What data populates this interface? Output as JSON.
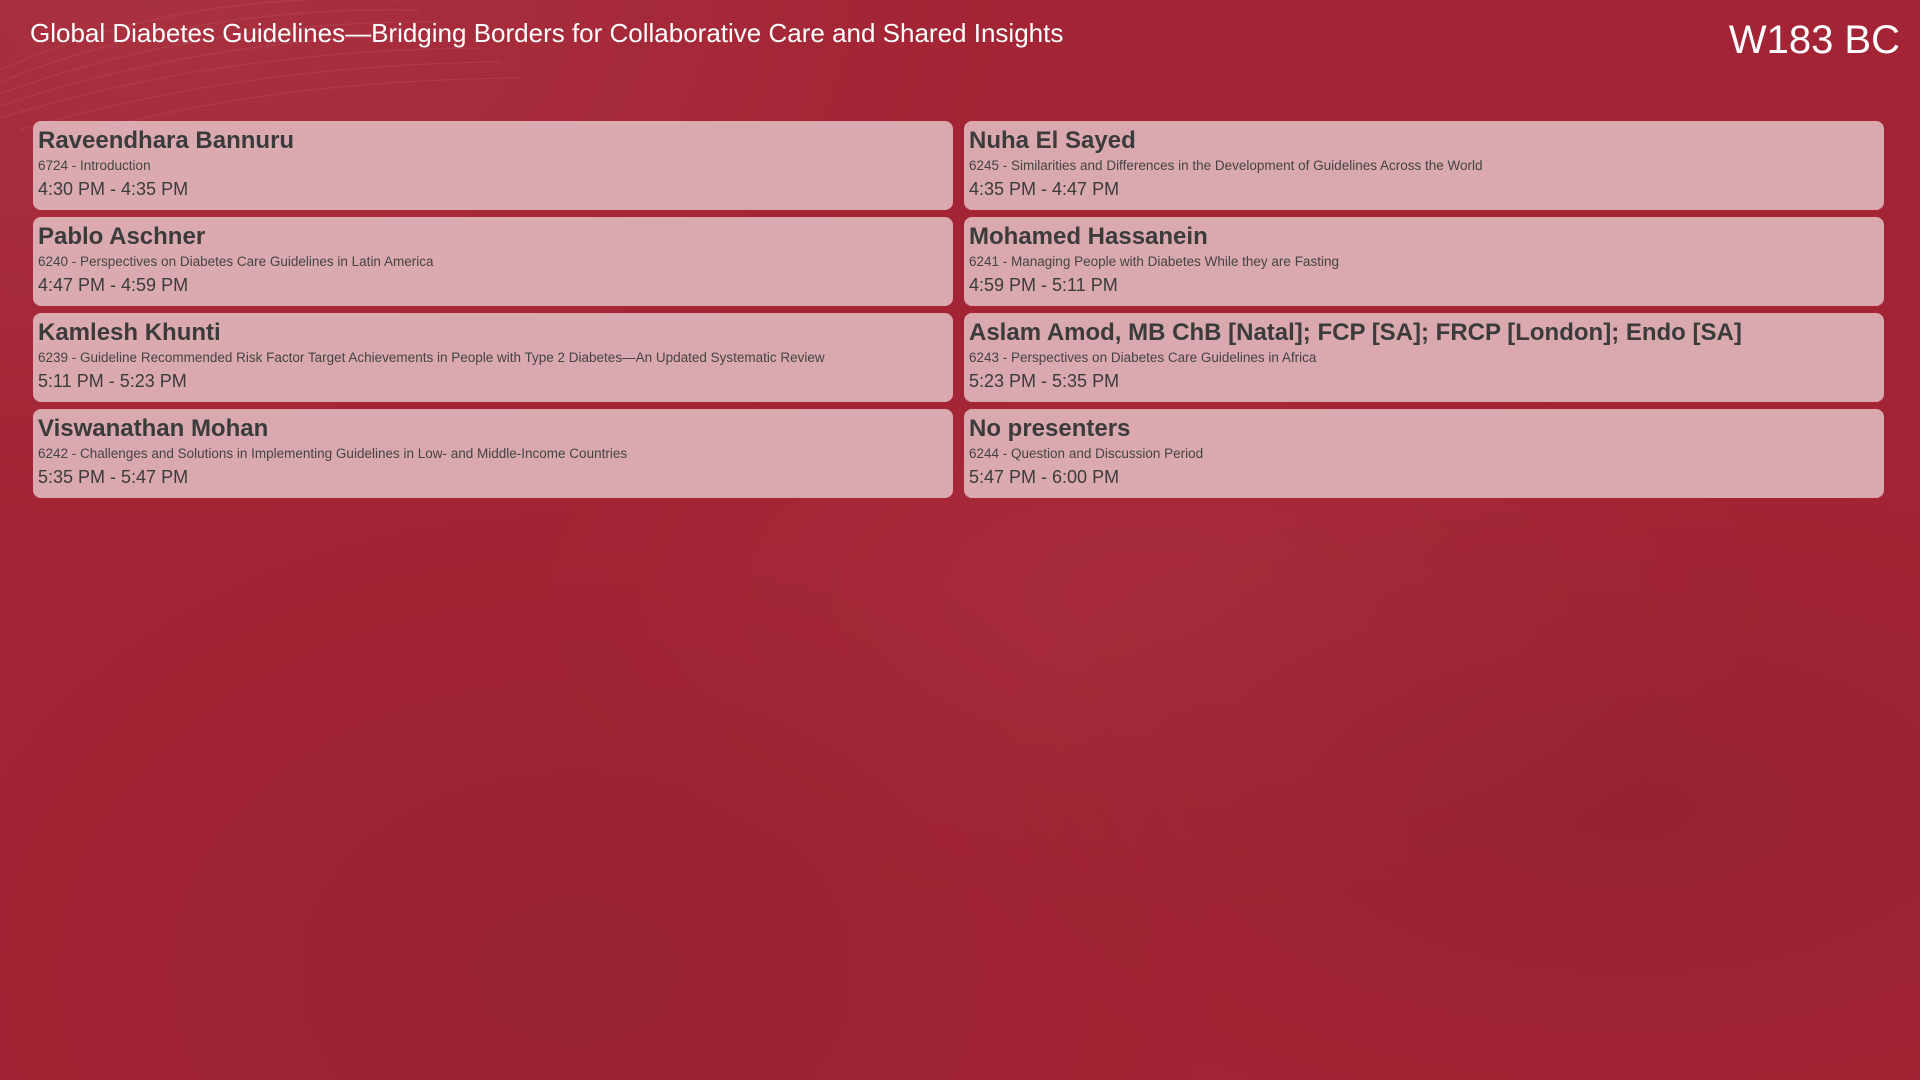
{
  "header": {
    "session_title": "Global Diabetes Guidelines—Bridging Borders for Collaborative Care and Shared Insights",
    "room": "W183 BC"
  },
  "schedule": [
    {
      "presenter": "Raveendhara Bannuru",
      "talk": "6724 - Introduction",
      "time": "4:30 PM - 4:35 PM"
    },
    {
      "presenter": "Nuha El Sayed",
      "talk": "6245 - Similarities and Differences in the Development of Guidelines Across the World",
      "time": "4:35 PM - 4:47 PM"
    },
    {
      "presenter": "Pablo Aschner",
      "talk": "6240 - Perspectives on Diabetes Care Guidelines in Latin America",
      "time": "4:47 PM - 4:59 PM"
    },
    {
      "presenter": "Mohamed Hassanein",
      "talk": "6241 - Managing People with Diabetes While they are Fasting",
      "time": "4:59 PM - 5:11 PM"
    },
    {
      "presenter": "Kamlesh Khunti",
      "talk": "6239 - Guideline Recommended Risk Factor Target Achievements in People with Type 2 Diabetes—An Updated Systematic Review",
      "time": "5:11 PM - 5:23 PM"
    },
    {
      "presenter": "Aslam Amod, MB ChB [Natal]; FCP [SA]; FRCP [London]; Endo [SA]",
      "talk": "6243 - Perspectives on Diabetes Care Guidelines in Africa",
      "time": "5:23 PM - 5:35 PM"
    },
    {
      "presenter": "Viswanathan Mohan",
      "talk": "6242 - Challenges and Solutions in Implementing Guidelines in Low- and Middle-Income Countries",
      "time": "5:35 PM - 5:47 PM"
    },
    {
      "presenter": "No presenters",
      "talk": "6244 - Question and Discussion Period",
      "time": "5:47 PM - 6:00 PM"
    }
  ],
  "colors": {
    "background": "#a32434",
    "card": "#eed6da",
    "text_dark": "#3b3b3b",
    "text_light": "#ffffff"
  }
}
